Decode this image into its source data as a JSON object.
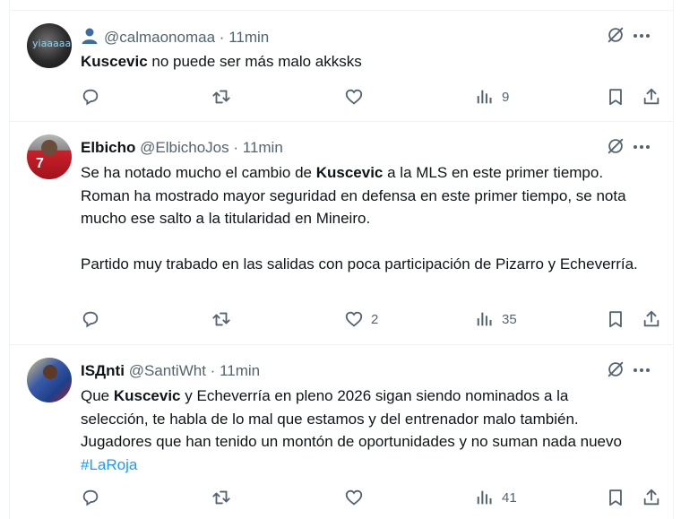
{
  "tweets": [
    {
      "name": "",
      "has_person_icon": true,
      "handle": "@calmaonomaa",
      "dot": "·",
      "time": "11min",
      "avatar_overlay": "yiaaaaa",
      "text_bold": "Kuscevic",
      "text_rest": " no puede ser más malo akksks",
      "counts": {
        "reply": "",
        "retweet": "",
        "like": "",
        "views": "9"
      }
    },
    {
      "name": "Elbicho",
      "handle": "@ElbichoJos",
      "dot": "·",
      "time": "11min",
      "avatar_overlay": "7",
      "p1_a": "Se ha notado mucho el cambio de ",
      "p1_bold": "Kuscevic",
      "p1_b": " a la MLS en este primer tiempo.  Roman ha mostrado mayor seguridad en defensa en este primer tiempo, se nota mucho ese salto a la titularidad en Mineiro.",
      "p2": "Partido muy trabado en las salidas con poca participación de Pizarro y Echeverría.",
      "counts": {
        "reply": "",
        "retweet": "",
        "like": "2",
        "views": "35"
      }
    },
    {
      "name": "ISДnti",
      "handle": "@SantiWht",
      "dot": "·",
      "time": "11min",
      "t_a": "Que ",
      "t_bold": "Kuscevic",
      "t_b": " y Echeverría en pleno 2026 sigan siendo nominados a la selección, te habla de lo mal que estamos y del entrenador malo también. Jugadores que han tenido un montón de oportunidades y no suman nada nuevo ",
      "t_hashtag": "#LaRoja",
      "counts": {
        "reply": "",
        "retweet": "",
        "like": "",
        "views": "41"
      }
    }
  ],
  "icons": {
    "reply": "reply-icon",
    "retweet": "retweet-icon",
    "like": "heart-icon",
    "views": "views-icon",
    "bookmark": "bookmark-icon",
    "share": "share-icon",
    "grok": "grok-icon",
    "more": "more-icon",
    "person": "person-icon"
  },
  "colors": {
    "text": "#0f1419",
    "muted": "#536471",
    "hashtag": "#1d9bf0",
    "divider": "#eff3f4"
  }
}
